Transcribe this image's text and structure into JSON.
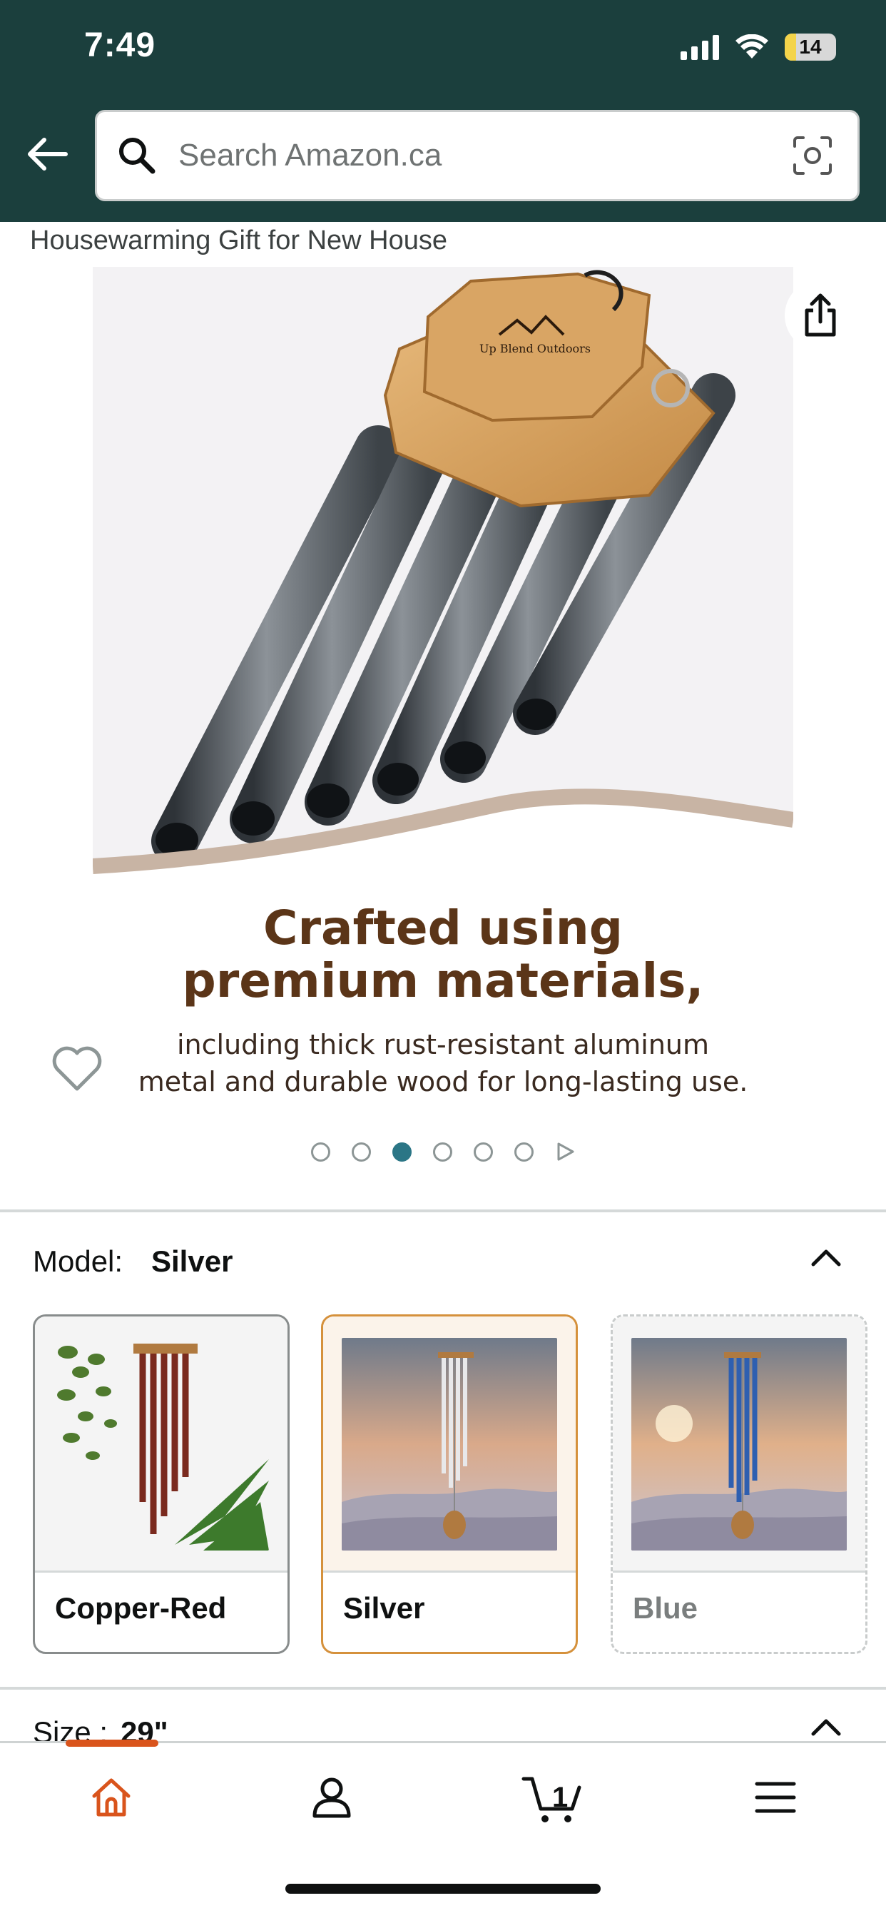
{
  "status_bar": {
    "time": "7:49",
    "battery": "14"
  },
  "header": {
    "search_placeholder": "Search Amazon.ca"
  },
  "product": {
    "title_snippet": "Housewarming Gift for New House"
  },
  "gallery": {
    "heading_line1": "Crafted using",
    "heading_line2": "premium materials,",
    "body_line1": "including thick rust-resistant aluminum",
    "body_line2": "metal and durable wood for long-lasting use.",
    "dot_count": 6,
    "active_dot": 3
  },
  "model": {
    "label": "Model:",
    "selected": "Silver",
    "options": [
      {
        "label": "Copper-Red",
        "state": "available"
      },
      {
        "label": "Silver",
        "state": "selected"
      },
      {
        "label": "Blue",
        "state": "unavailable"
      }
    ]
  },
  "size": {
    "label": "Size :",
    "value": "29\""
  },
  "bottom_nav": {
    "cart_count": "1"
  },
  "colors": {
    "header_bg": "#1b3f3d",
    "accent": "#d9541c",
    "selected_border": "#d5913c",
    "dot_active": "#2b7686"
  }
}
